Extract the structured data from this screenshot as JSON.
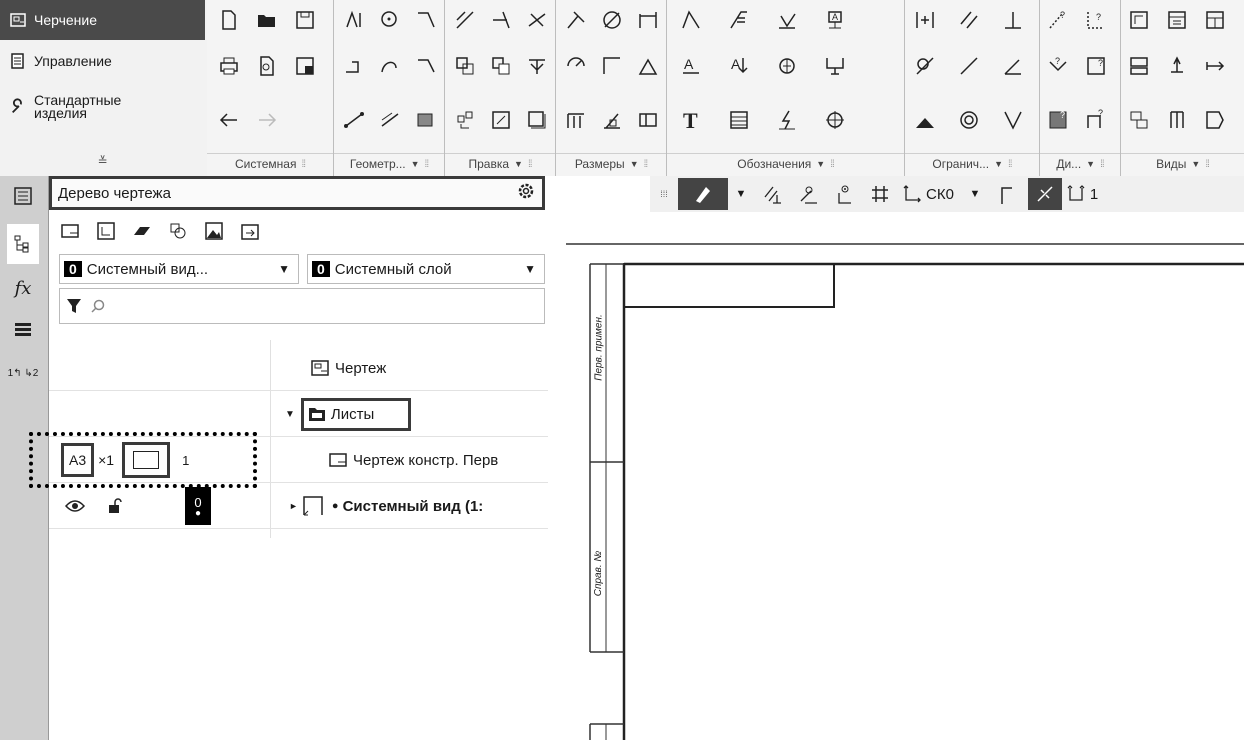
{
  "app_panel": {
    "items": [
      {
        "label": "Черчение",
        "icon": "drawing-icon",
        "active": true
      },
      {
        "label": "Управление",
        "icon": "document-icon",
        "active": false
      },
      {
        "label_line1": "Стандартные",
        "label_line2": "изделия",
        "icon": "wrench-icon",
        "active": false
      }
    ],
    "collapse_glyph": "≚"
  },
  "toolbar": {
    "groups": [
      {
        "label": "Системная"
      },
      {
        "label": "Геометр..."
      },
      {
        "label": "Правка"
      },
      {
        "label": "Размеры"
      },
      {
        "label": "Обозначения"
      },
      {
        "label": "Огранич..."
      },
      {
        "label": "Ди..."
      },
      {
        "label": "Виды"
      }
    ],
    "dim_glyph": "A",
    "text_glyph": "T"
  },
  "tree_panel": {
    "title": "Дерево чертежа",
    "view_select": {
      "number": "0",
      "value": "Системный вид..."
    },
    "layer_select": {
      "number": "0",
      "value": "Системный слой"
    },
    "search_placeholder": "",
    "nodes": {
      "drawing": "Чертеж",
      "sheets": "Листы",
      "sheet_item": "Чертеж констр. Перв",
      "system_view": "Системный вид (1:"
    },
    "sheet_row": {
      "format": "A3",
      "multiplier": "×1",
      "count": "1"
    },
    "view_row": {
      "layer_number": "0"
    }
  },
  "side_strip": {
    "fx": "fx",
    "order": "1↰ ↳2"
  },
  "toolbar2": {
    "cs_label": "СК0",
    "step_value": "1"
  },
  "canvas": {
    "title_block_text_1": "Перв. примен.",
    "title_block_text_2": "Справ. №"
  }
}
